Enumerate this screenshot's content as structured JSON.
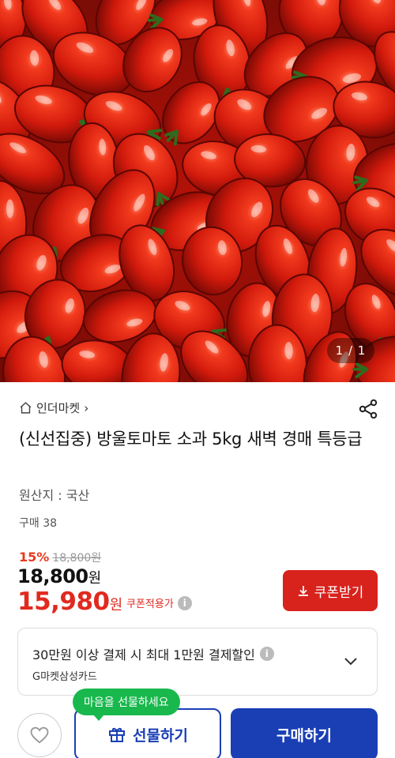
{
  "gallery": {
    "counter": "1 / 1"
  },
  "store": {
    "name": "인더마켓",
    "chevron": "›",
    "home_icon": "home-icon",
    "share_icon": "share-icon"
  },
  "product": {
    "title": "(신선집중) 방울토마토 소과 5kg 새벽 경매 특등급",
    "origin": "원산지 : 국산",
    "purchase_count": "구매 38"
  },
  "pricing": {
    "discount_rate": "15%",
    "original_price": "18,800원",
    "price_number": "18,800",
    "price_unit": "원",
    "coupon_price_number": "15,980",
    "coupon_price_unit": "원",
    "coupon_note": "쿠폰적용가",
    "coupon_button": "쿠폰받기",
    "accent_color": "#e02a1f"
  },
  "card_promo": {
    "headline": "30만원 이상 결제 시 최대 1만원 결제할인",
    "card_name": "G마켓삼성카드"
  },
  "bottom_bar": {
    "gift_tooltip": "마음을 선물하세요",
    "gift_button": "선물하기",
    "buy_button": "구매하기",
    "brand_color": "#1a3fb5"
  }
}
